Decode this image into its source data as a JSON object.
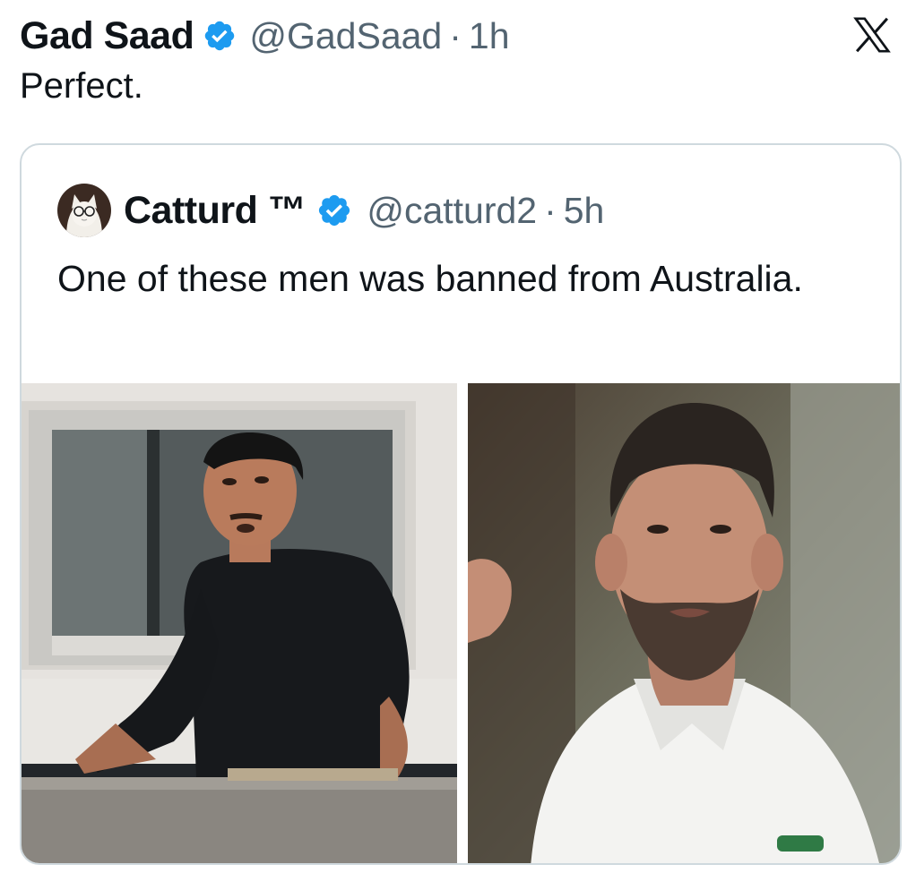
{
  "tweet": {
    "author_name": "Gad Saad",
    "handle": "@GadSaad",
    "separator": "·",
    "time": "1h",
    "text": "Perfect."
  },
  "quoted_tweet": {
    "author_name": "Catturd ™",
    "handle": "@catturd2",
    "separator": "·",
    "time": "5h",
    "text": "One of these men was banned from Australia.",
    "media": [
      {
        "kind": "photo"
      },
      {
        "kind": "photo"
      }
    ]
  },
  "icons": {
    "verified": "verified-badge-icon",
    "brand": "x-logo-icon"
  },
  "colors": {
    "verified_blue": "#1d9bf0",
    "secondary_text": "#536471",
    "border": "#cfd9de"
  }
}
